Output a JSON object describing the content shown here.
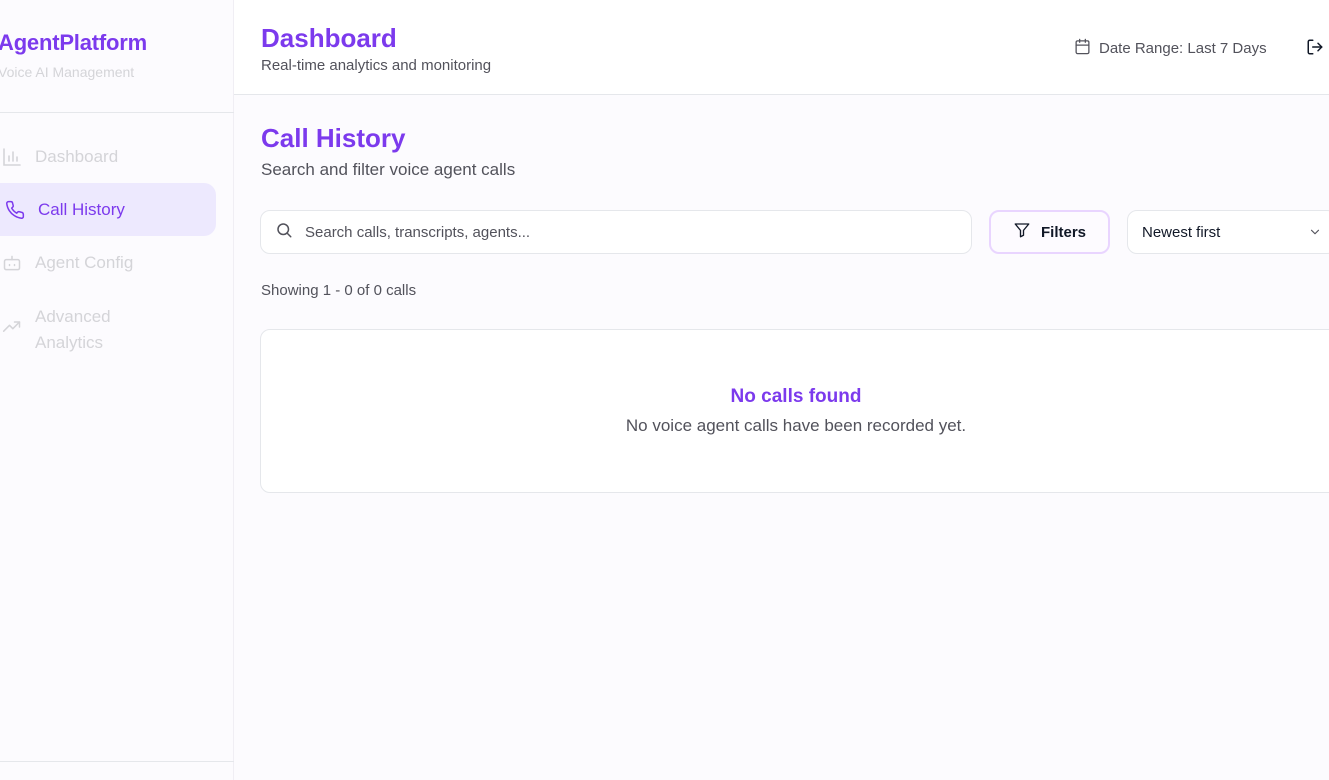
{
  "brand": {
    "title": "AgentPlatform",
    "subtitle": "Voice AI Management"
  },
  "sidebar": {
    "items": [
      {
        "label": "Dashboard",
        "icon": "bar-chart-icon",
        "active": false
      },
      {
        "label": "Call History",
        "icon": "phone-icon",
        "active": true
      },
      {
        "label": "Agent Config",
        "icon": "bot-icon",
        "active": false
      },
      {
        "label": "Advanced",
        "label2": "Analytics",
        "icon": "trending-up-icon",
        "active": false
      }
    ]
  },
  "header": {
    "title": "Dashboard",
    "subtitle": "Real-time analytics and monitoring",
    "date_range": "Date Range: Last 7 Days",
    "date_icon": "calendar-icon",
    "logout_icon": "logout-icon"
  },
  "main": {
    "title": "Call History",
    "subtitle": "Search and filter voice agent calls",
    "search": {
      "placeholder": "Search calls, transcripts, agents...",
      "value": "",
      "icon": "search-icon"
    },
    "filters_label": "Filters",
    "filters_icon": "filter-icon",
    "sort": {
      "selected": "Newest first",
      "icon": "chevron-down-icon"
    },
    "showing": "Showing 1 - 0 of 0 calls",
    "empty": {
      "title": "No calls found",
      "description": "No voice agent calls have been recorded yet."
    }
  },
  "colors": {
    "accent": "#7c3aed",
    "active_bg": "#ede9fe",
    "muted": "#52525b"
  }
}
